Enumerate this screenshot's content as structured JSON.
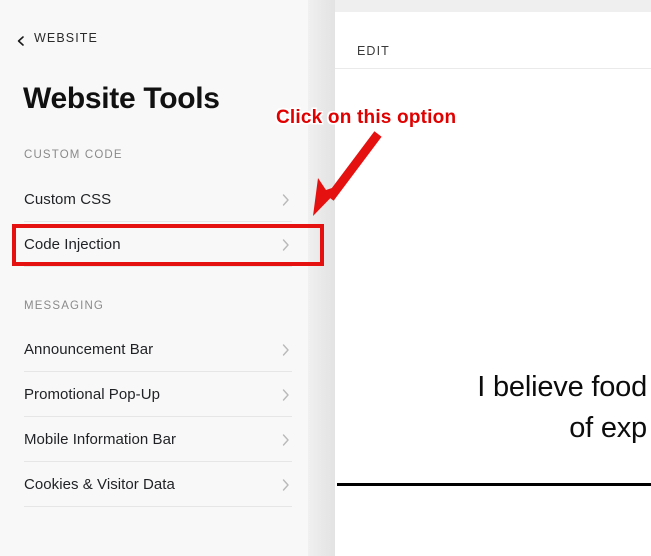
{
  "sidebar": {
    "back": {
      "label": "WEBSITE",
      "icon": "chevron-left-icon"
    },
    "title": "Website Tools",
    "sections": [
      {
        "label": "CUSTOM CODE",
        "items": [
          {
            "label": "Custom CSS",
            "chevron": "chevron-right-icon"
          },
          {
            "label": "Code Injection",
            "chevron": "chevron-right-icon"
          }
        ]
      },
      {
        "label": "MESSAGING",
        "items": [
          {
            "label": "Announcement Bar",
            "chevron": "chevron-right-icon"
          },
          {
            "label": "Promotional Pop-Up",
            "chevron": "chevron-right-icon"
          },
          {
            "label": "Mobile Information Bar",
            "chevron": "chevron-right-icon"
          },
          {
            "label": "Cookies & Visitor Data",
            "chevron": "chevron-right-icon"
          }
        ]
      }
    ]
  },
  "preview": {
    "edit_label": "EDIT",
    "headline_line1": "I believe food",
    "headline_line2": "of exp"
  },
  "annotation": {
    "text": "Click on this option",
    "arrow_icon": "arrow-down-left-icon",
    "color": "#e00000",
    "highlight_color": "#e51111",
    "outline_color": "#ffffff"
  },
  "colors": {
    "sidebar_bg": "#f8f8f8",
    "panel_bg": "#ffffff",
    "row_text": "#1f2124",
    "section_label": "#8a8a8a",
    "divider": "#e6e6e6",
    "rule": "#000000"
  }
}
